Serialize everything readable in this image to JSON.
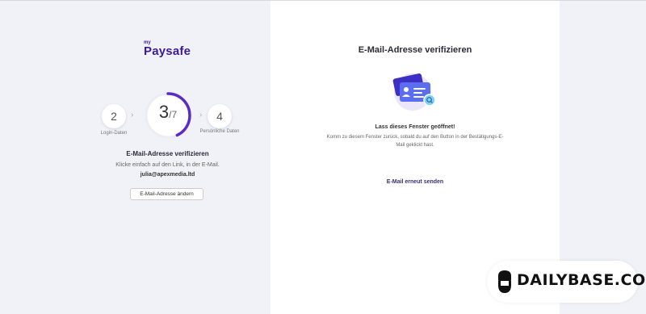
{
  "logo": {
    "my": "my",
    "name": "Paysafe"
  },
  "progress": {
    "prev_step": "2",
    "prev_label": "Login-Daten",
    "current": "3",
    "total": "/7",
    "fraction": 0.43,
    "next_step": "4",
    "next_label": "Persönliche Daten",
    "accent": "#5b2bc8"
  },
  "step": {
    "title": "E-Mail-Adresse verifizieren",
    "description": "Klicke einfach auf den Link, in der E-Mail.",
    "email": "julia@apexmedia.ltd",
    "change_button": "E-Mail-Adresse ändern"
  },
  "main": {
    "title": "E-Mail-Adresse verifizieren",
    "illustration": "email-verification-illustration",
    "info_title": "Lass dieses Fenster geöffnet!",
    "info_text": "Komm zu diesem Fenster zurück, sobald du auf den Button in der Bestätigungs-E-Mail geklickt hast.",
    "resend_link": "E-Mail erneut senden"
  },
  "watermark": {
    "text": "DAILYBASE.COM",
    "icon": "bearded-man-icon"
  }
}
